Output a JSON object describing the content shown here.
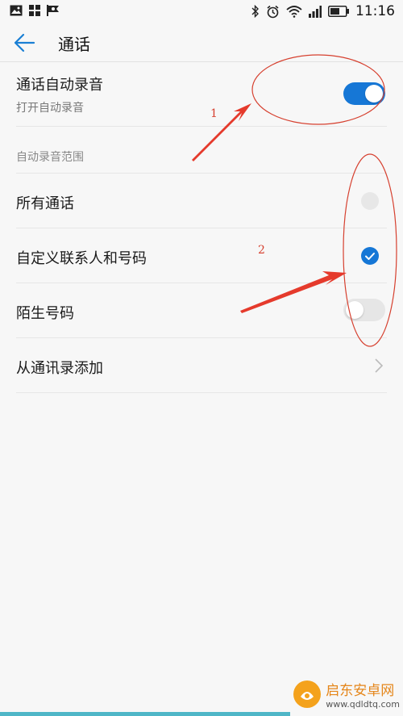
{
  "status_bar": {
    "time": "11:16",
    "left_icons": [
      "image-icon",
      "grid-icon",
      "flag-icon"
    ],
    "right_icons": [
      "bluetooth-icon",
      "alarm-icon",
      "wifi-icon",
      "signal-icon",
      "battery-icon"
    ]
  },
  "header": {
    "back_icon": "back-arrow-icon",
    "title": "通话"
  },
  "auto_record": {
    "title": "通话自动录音",
    "subtitle": "打开自动录音",
    "enabled": true
  },
  "section": {
    "label": "自动录音范围"
  },
  "options": [
    {
      "label": "所有通话",
      "control": "radio",
      "checked": false
    },
    {
      "label": "自定义联系人和号码",
      "control": "radio",
      "checked": true
    },
    {
      "label": "陌生号码",
      "control": "toggle",
      "checked": false
    },
    {
      "label": "从通讯录添加",
      "control": "chevron"
    }
  ],
  "annotations": {
    "marker_1": "1",
    "marker_2": "2"
  },
  "watermark": {
    "name": "启东安卓网",
    "url": "www.qdldtq.com"
  },
  "colors": {
    "accent": "#1677d6",
    "annotation": "#d6402f",
    "background": "#f7f7f7"
  }
}
